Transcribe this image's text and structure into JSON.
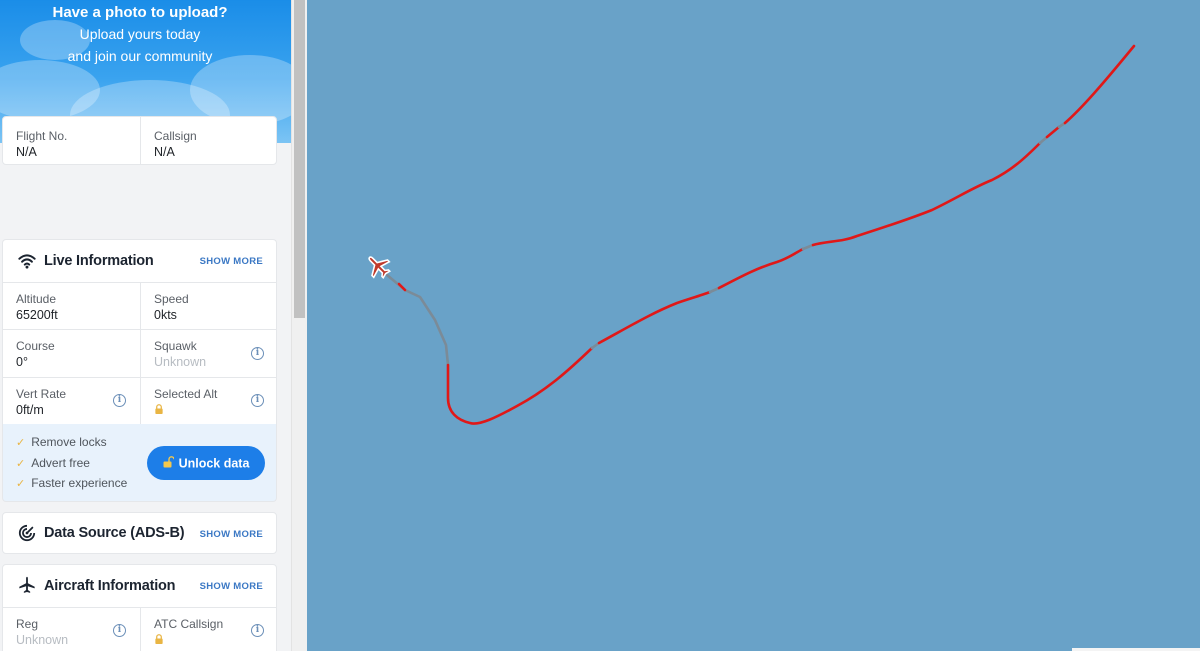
{
  "banner": {
    "title": "Have a photo to upload?",
    "line1": "Upload yours today",
    "line2": "and join our community"
  },
  "flight": {
    "flight_no_label": "Flight No.",
    "flight_no_value": "N/A",
    "callsign_label": "Callsign",
    "callsign_value": "N/A"
  },
  "live": {
    "title": "Live Information",
    "show_more": "SHOW MORE",
    "altitude_label": "Altitude",
    "altitude_value": "65200ft",
    "speed_label": "Speed",
    "speed_value": "0kts",
    "course_label": "Course",
    "course_value": "0°",
    "squawk_label": "Squawk",
    "squawk_value": "Unknown",
    "vert_rate_label": "Vert Rate",
    "vert_rate_value": "0ft/m",
    "selected_alt_label": "Selected Alt"
  },
  "promo": {
    "perks": [
      "Remove locks",
      "Advert free",
      "Faster experience"
    ],
    "unlock_label": "Unlock data"
  },
  "data_source": {
    "title": "Data Source (ADS-B)",
    "show_more": "SHOW MORE"
  },
  "aircraft": {
    "title": "Aircraft Information",
    "show_more": "SHOW MORE",
    "reg_label": "Reg",
    "reg_value": "Unknown",
    "atc_callsign_label": "ATC Callsign"
  },
  "icons": {
    "wifi": "wifi-icon",
    "radar": "radar-icon",
    "plane": "airplane-icon",
    "info": "info-icon",
    "lock": "lock-icon",
    "unlock": "unlock-icon",
    "tick": "check-icon"
  },
  "colors": {
    "track_red": "#e01818",
    "track_gray": "#7b8b98",
    "map_water": "#69a2c8",
    "accent_blue": "#1d7ee8",
    "aircraft_marker": "#c0392b"
  }
}
